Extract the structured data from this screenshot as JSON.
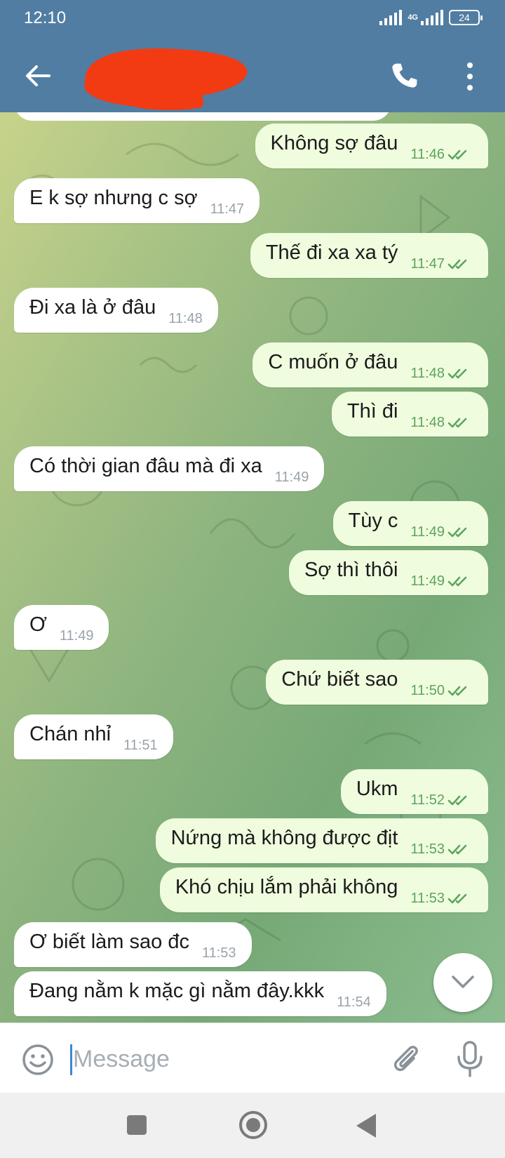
{
  "status_bar": {
    "time": "12:10",
    "network": "4G",
    "battery": "24"
  },
  "header": {
    "contact_name": ""
  },
  "messages": [
    {
      "dir": "out",
      "text": "Không sợ đâu",
      "time": "11:46"
    },
    {
      "dir": "in",
      "text": "E k sợ nhưng c sợ",
      "time": "11:47"
    },
    {
      "dir": "out",
      "text": "Thế đi xa xa tý",
      "time": "11:47"
    },
    {
      "dir": "in",
      "text": "Đi xa là ở đâu",
      "time": "11:48"
    },
    {
      "dir": "out",
      "text": "C muốn ở đâu",
      "time": "11:48"
    },
    {
      "dir": "out",
      "text": "Thì đi",
      "time": "11:48"
    },
    {
      "dir": "in",
      "text": "Có thời gian đâu mà đi xa",
      "time": "11:49"
    },
    {
      "dir": "out",
      "text": "Tùy c",
      "time": "11:49"
    },
    {
      "dir": "out",
      "text": "Sợ thì thôi",
      "time": "11:49"
    },
    {
      "dir": "in",
      "text": "Ơ",
      "time": "11:49"
    },
    {
      "dir": "out",
      "text": "Chứ biết sao",
      "time": "11:50"
    },
    {
      "dir": "in",
      "text": "Chán nhỉ",
      "time": "11:51"
    },
    {
      "dir": "out",
      "text": "Ukm",
      "time": "11:52"
    },
    {
      "dir": "out",
      "text": "Nứng mà không được địt",
      "time": "11:53"
    },
    {
      "dir": "out",
      "text": "Khó chịu lắm phải không",
      "time": "11:53"
    },
    {
      "dir": "in",
      "text": "Ơ biết làm sao đc",
      "time": "11:53"
    },
    {
      "dir": "in",
      "text": "Đang nằm k mặc gì nằm đây.kkk",
      "time": "11:54"
    }
  ],
  "composer": {
    "placeholder": "Message"
  },
  "colors": {
    "header": "#517da2",
    "outgoing_bubble": "#effdde",
    "incoming_bubble": "#ffffff",
    "read_tick": "#5ea35e",
    "redaction": "#f23b12"
  },
  "icons": [
    "back-arrow-icon",
    "phone-icon",
    "more-vert-icon",
    "double-check-icon",
    "chevron-down-icon",
    "emoji-icon",
    "paperclip-icon",
    "microphone-icon"
  ]
}
